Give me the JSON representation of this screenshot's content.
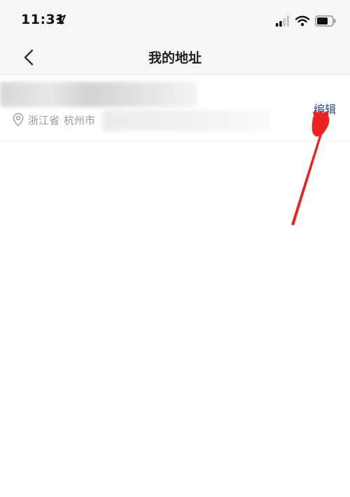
{
  "status_bar": {
    "time": "11:31",
    "icons": [
      "location-arrow-icon",
      "cellular-signal-icon",
      "wifi-icon",
      "battery-icon"
    ]
  },
  "nav": {
    "title": "我的地址",
    "back_icon": "chevron-left-icon"
  },
  "address": {
    "province": "浙江省",
    "city": "杭州市",
    "edit_label": "编辑",
    "pin_icon": "location-pin-icon"
  },
  "colors": {
    "nav_background": "#f6f6f6",
    "edit_link": "#2a4e7c",
    "address_text": "#9a9a9a",
    "annotation": "#ee2222"
  }
}
